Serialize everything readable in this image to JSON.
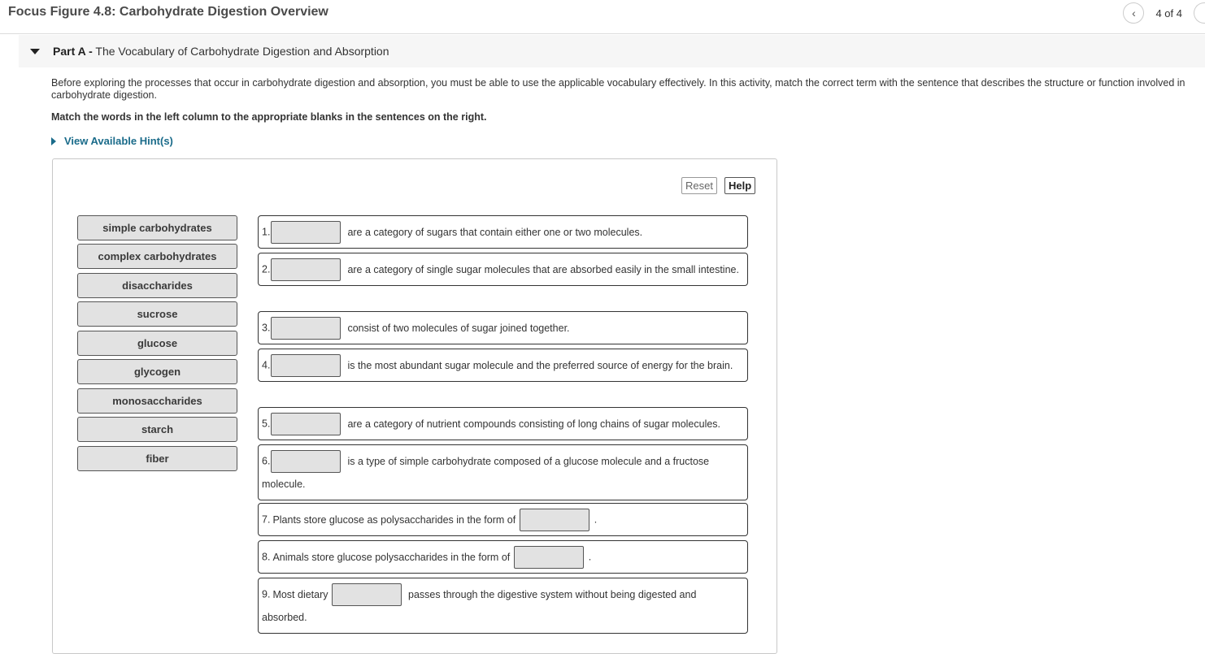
{
  "header": {
    "title": "Focus Figure 4.8: Carbohydrate Digestion Overview",
    "nav_prev_icon": "chevron-left-icon",
    "page_count": "4 of 4"
  },
  "part": {
    "label": "Part A -",
    "title": "The Vocabulary of Carbohydrate Digestion and Absorption"
  },
  "intro": "Before exploring the processes that occur in carbohydrate digestion and absorption, you must be able to use the applicable vocabulary effectively. In this activity, match the correct term with the sentence that describes the structure or function involved in carbohydrate digestion.",
  "instruction": "Match the words in the left column to the appropriate blanks in the sentences on the right.",
  "hint_label": "View Available Hint(s)",
  "toolbar": {
    "reset_label": "Reset",
    "help_label": "Help"
  },
  "terms": [
    "simple carbohydrates",
    "complex carbohydrates",
    "disaccharides",
    "sucrose",
    "glucose",
    "glycogen",
    "monosaccharides",
    "starch",
    "fiber"
  ],
  "sentences": [
    {
      "num": "1.",
      "before": "",
      "after": "are a category of sugars that contain either one or two molecules."
    },
    {
      "num": "2.",
      "before": "",
      "after": "are a category of single sugar molecules that are absorbed easily in the small intestine."
    },
    {
      "num": "3.",
      "before": "",
      "after": "consist of two molecules of sugar joined together."
    },
    {
      "num": "4.",
      "before": "",
      "after": "is the most abundant sugar molecule and the preferred source of energy for the brain."
    },
    {
      "num": "5.",
      "before": "",
      "after": "are a category of nutrient compounds consisting of long chains of sugar molecules."
    },
    {
      "num": "6.",
      "before": "",
      "after": "is a type of simple carbohydrate composed of a glucose molecule and a fructose molecule."
    },
    {
      "num": "7.",
      "before": "Plants store glucose as polysaccharides in the form of",
      "after": "."
    },
    {
      "num": "8.",
      "before": "Animals store glucose polysaccharides in the form of",
      "after": "."
    },
    {
      "num": "9.",
      "before": "Most dietary",
      "after": "passes through the digestive system without being digested and absorbed."
    }
  ]
}
